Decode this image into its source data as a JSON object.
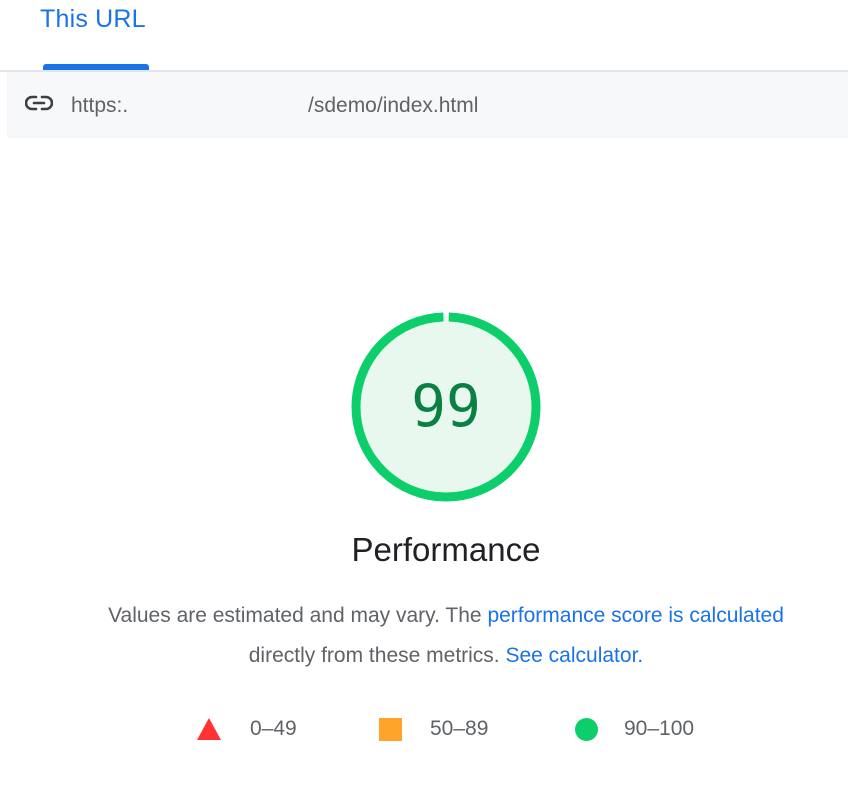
{
  "tab": {
    "label": "This URL"
  },
  "url": {
    "icon": "link-icon",
    "prefix": "https:.",
    "suffix": "/sdemo/index.html"
  },
  "gauge": {
    "score": "99",
    "score_fraction": 0.99,
    "ring_color": "#0cce6b",
    "fill_color": "#e8f8ee",
    "text_color": "#0b8043"
  },
  "category": {
    "title": "Performance"
  },
  "description": {
    "text_before": "Values are estimated and may vary. The ",
    "link_score": "performance score is calculated",
    "text_middle": "directly from these metrics. ",
    "link_calculator": "See calculator."
  },
  "legend": {
    "fail": {
      "range": "0–49",
      "icon": "red-triangle-icon",
      "color": "#ff3333"
    },
    "average": {
      "range": "50–89",
      "icon": "orange-square-icon",
      "color": "#ffa32a"
    },
    "pass": {
      "range": "90–100",
      "icon": "green-circle-icon",
      "color": "#0cce6b"
    }
  }
}
